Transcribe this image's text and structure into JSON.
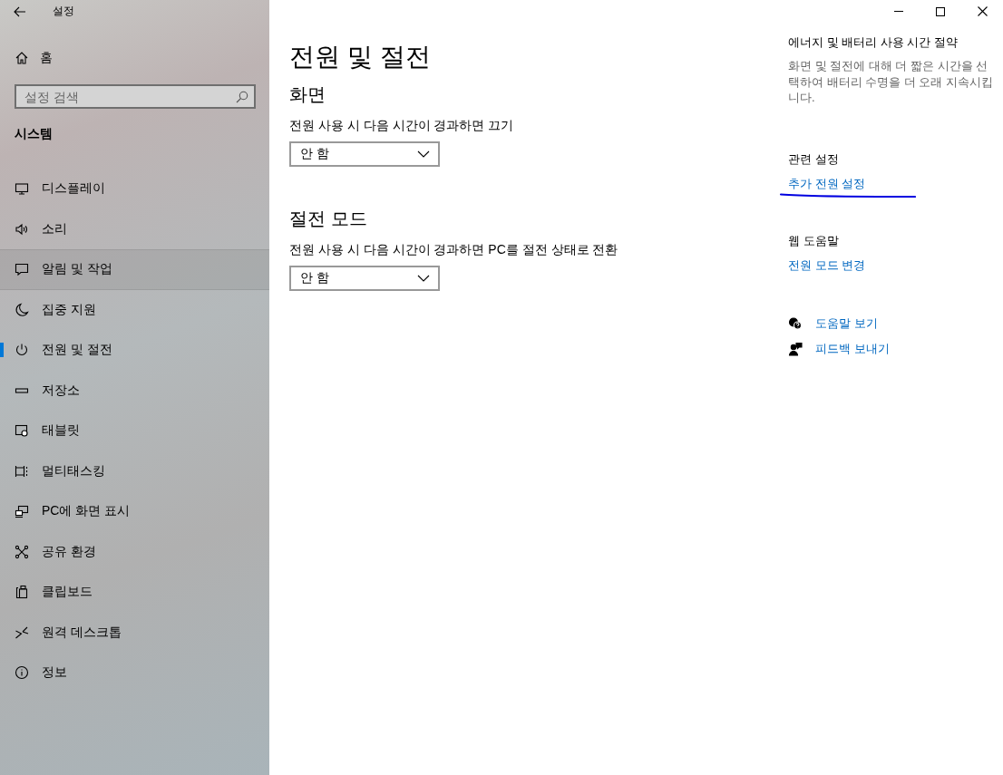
{
  "window": {
    "title": "설정"
  },
  "sidebar": {
    "home": "홈",
    "search": {
      "placeholder": "설정 검색"
    },
    "section": "시스템",
    "items": [
      {
        "label": "디스플레이",
        "selected": false,
        "hovered": false
      },
      {
        "label": "소리",
        "selected": false,
        "hovered": false
      },
      {
        "label": "알림 및 작업",
        "selected": false,
        "hovered": true
      },
      {
        "label": "집중 지원",
        "selected": false,
        "hovered": false
      },
      {
        "label": "전원 및 절전",
        "selected": true,
        "hovered": false
      },
      {
        "label": "저장소",
        "selected": false,
        "hovered": false
      },
      {
        "label": "태블릿",
        "selected": false,
        "hovered": false
      },
      {
        "label": "멀티태스킹",
        "selected": false,
        "hovered": false
      },
      {
        "label": "PC에 화면 표시",
        "selected": false,
        "hovered": false
      },
      {
        "label": "공유 환경",
        "selected": false,
        "hovered": false
      },
      {
        "label": "클립보드",
        "selected": false,
        "hovered": false
      },
      {
        "label": "원격 데스크톱",
        "selected": false,
        "hovered": false
      },
      {
        "label": "정보",
        "selected": false,
        "hovered": false
      }
    ]
  },
  "page": {
    "title": "전원 및 절전",
    "sections": [
      {
        "heading": "화면",
        "label": "전원 사용 시 다음 시간이 경과하면 끄기",
        "value": "안 함"
      },
      {
        "heading": "절전 모드",
        "label": "전원 사용 시 다음 시간이 경과하면 PC를 절전 상태로 전환",
        "value": "안 함"
      }
    ]
  },
  "aside": {
    "heading": "에너지 및 배터리 사용 시간 절약",
    "description": "화면 및 절전에 대해 더 짧은 시간을 선택하여 배터리 수명을 더 오래 지속시킵니다.",
    "related": {
      "heading": "관련 설정",
      "link": "추가 전원 설정",
      "underlined": true
    },
    "web_help": {
      "heading": "웹 도움말",
      "link": "전원 모드 변경"
    },
    "help_links": [
      "도움말 보기",
      "피드백 보내기"
    ]
  }
}
